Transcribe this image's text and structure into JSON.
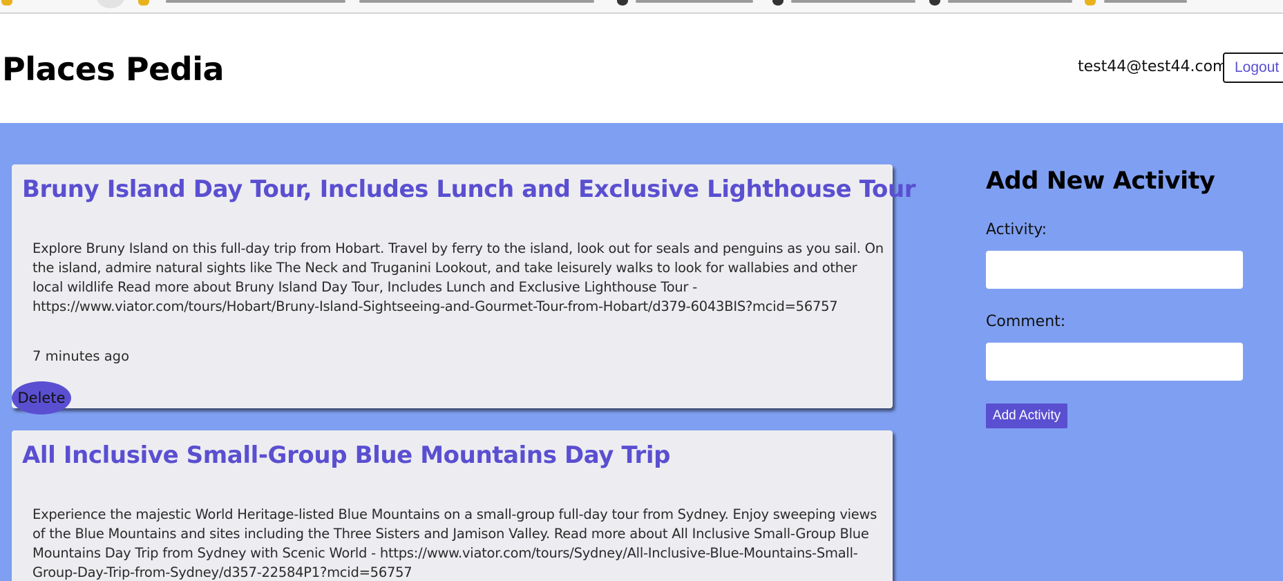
{
  "site": {
    "title": "Places Pedia",
    "user_email": "test44@test44.com",
    "logout_label": "Logout"
  },
  "activities": [
    {
      "title": "Bruny Island Day Tour, Includes Lunch and Exclusive Lighthouse Tour",
      "description": "Explore Bruny Island on this full-day trip from Hobart. Travel by ferry to the island, look out for seals and penguins as you sail. On the island, admire natural sights like The Neck and Truganini Lookout, and take leisurely walks to look for wallabies and other local wildlife Read more about Bruny Island Day Tour, Includes Lunch and Exclusive Lighthouse Tour - https://www.viator.com/tours/Hobart/Bruny-Island-Sightseeing-and-Gourmet-Tour-from-Hobart/d379-6043BIS?mcid=56757",
      "time": "7 minutes ago",
      "delete_label": "Delete"
    },
    {
      "title": "All Inclusive Small-Group Blue Mountains Day Trip",
      "description": "Experience the majestic World Heritage-listed Blue Mountains on a small-group full-day tour from Sydney. Enjoy sweeping views of the Blue Mountains and sites including the Three Sisters and Jamison Valley. Read more about All Inclusive Small-Group Blue Mountains Day Trip from Sydney with Scenic World - https://www.viator.com/tours/Sydney/All-Inclusive-Blue-Mountains-Small-Group-Day-Trip-from-Sydney/d357-22584P1?mcid=56757"
    }
  ],
  "form": {
    "title": "Add New Activity",
    "activity_label": "Activity:",
    "activity_value": "",
    "comment_label": "Comment:",
    "comment_value": "",
    "submit_label": "Add Activity"
  },
  "colors": {
    "accent": "#5a4fd1",
    "background": "#7fa0f2",
    "card": "#ededf1"
  }
}
